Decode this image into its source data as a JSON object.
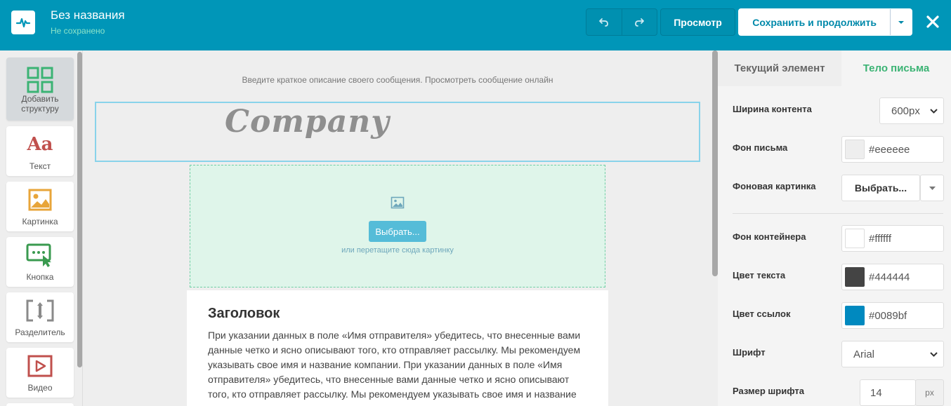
{
  "header": {
    "title": "Без названия",
    "status": "Не сохранено",
    "preview_label": "Просмотр",
    "save_label": "Сохранить и продолжить"
  },
  "sidebar": {
    "items": [
      {
        "label": "Добавить структуру",
        "icon": "grid-structure-icon"
      },
      {
        "label": "Текст",
        "icon": "text-aa-icon"
      },
      {
        "label": "Картинка",
        "icon": "image-icon"
      },
      {
        "label": "Кнопка",
        "icon": "button-cursor-icon"
      },
      {
        "label": "Разделитель",
        "icon": "divider-icon"
      },
      {
        "label": "Видео",
        "icon": "video-icon"
      }
    ]
  },
  "canvas": {
    "preheader": "Введите краткое описание своего сообщения. Просмотреть сообщение онлайн",
    "logo_text": "Company",
    "choose_button": "Выбрать...",
    "drop_hint": "или перетащите сюда картинку",
    "heading": "Заголовок",
    "body": "При указании данных в поле «Имя отправителя» убедитесь, что внесенные вами данные четко и ясно описывают того, кто отправляет рассылку. Мы рекомендуем указывать свое имя и название компании. При указании данных в поле «Имя отправителя» убедитесь, что внесенные вами данные четко и ясно описывают того, кто отправляет рассылку. Мы рекомендуем указывать свое имя и название"
  },
  "panel": {
    "tabs": [
      "Текущий элемент",
      "Тело письма"
    ],
    "content_width_label": "Ширина контента",
    "content_width_value": "600px",
    "bg_label": "Фон письма",
    "bg_value": "#eeeeee",
    "bg_image_label": "Фоновая картинка",
    "bg_image_button": "Выбрать...",
    "container_bg_label": "Фон контейнера",
    "container_bg_value": "#ffffff",
    "text_color_label": "Цвет текста",
    "text_color_value": "#444444",
    "link_color_label": "Цвет ссылок",
    "link_color_value": "#0089bf",
    "font_label": "Шрифт",
    "font_value": "Arial",
    "font_size_label": "Размер шрифта",
    "font_size_value": "14",
    "font_size_unit": "px"
  },
  "colors": {
    "header_bg": "#0096b8",
    "accent_green": "#3bb374",
    "link": "#0089bf"
  }
}
